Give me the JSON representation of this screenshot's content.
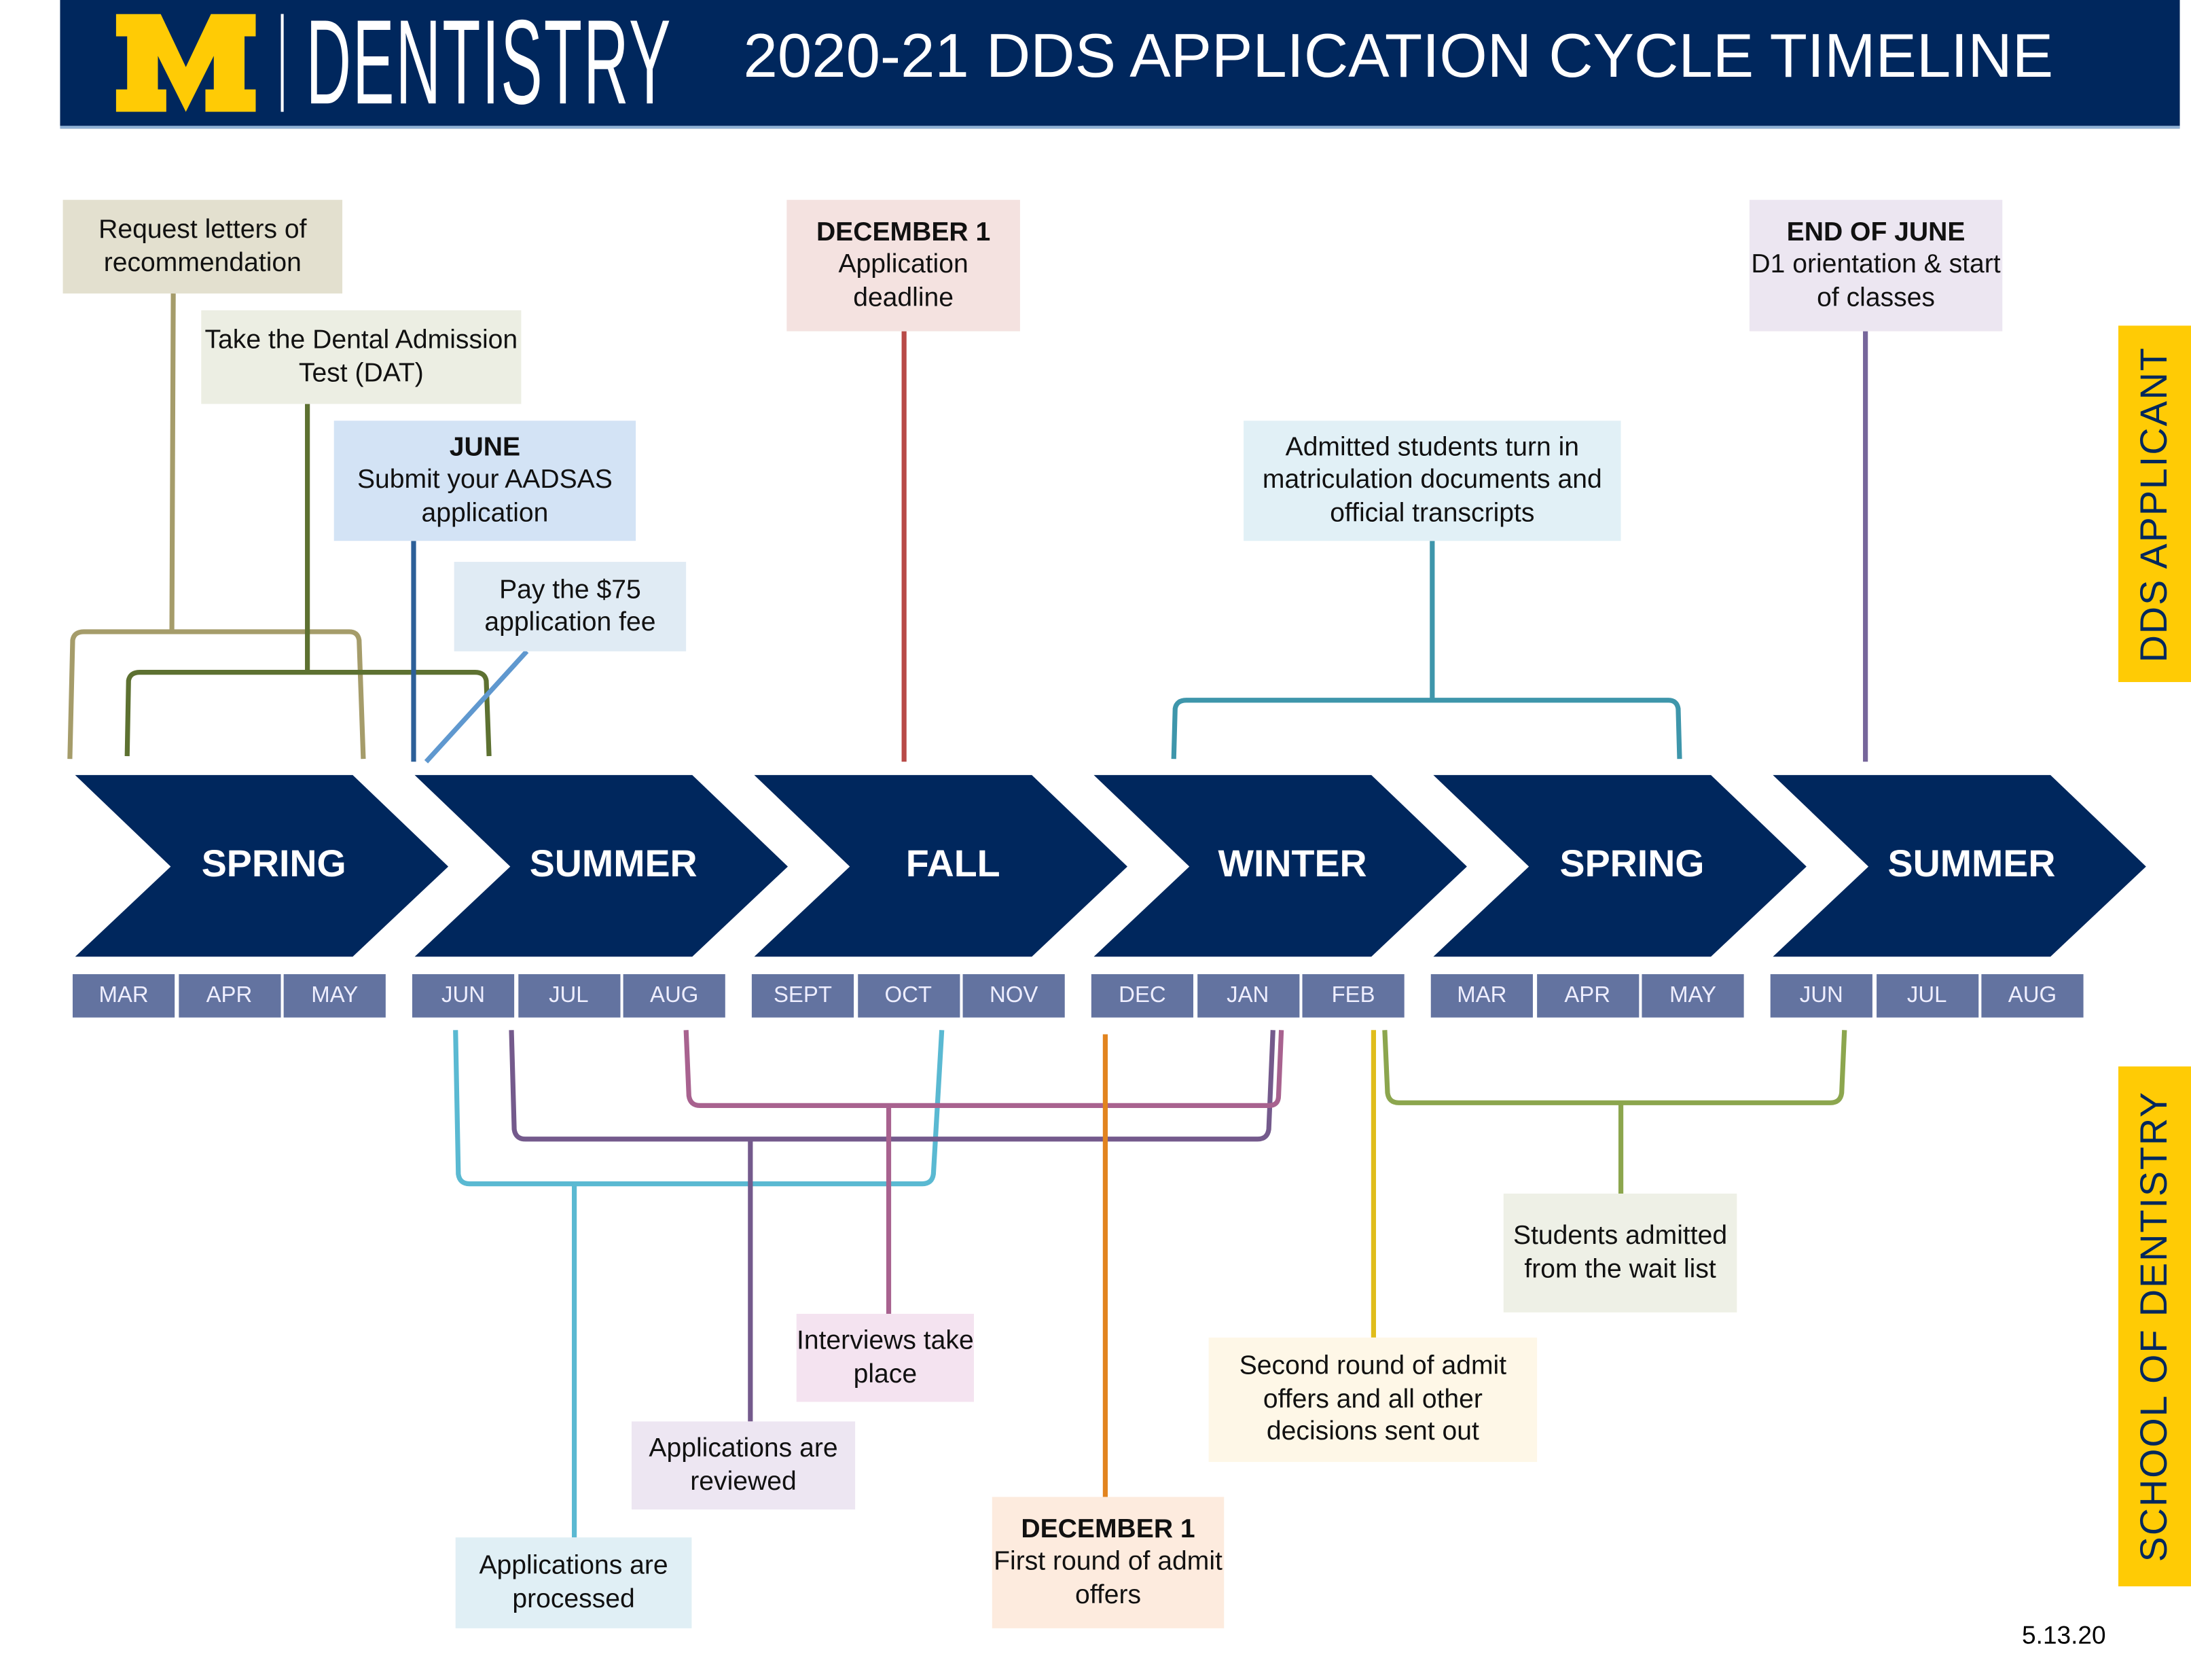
{
  "header": {
    "logo_letter": "M",
    "logo_text": "DENTISTRY",
    "title": "2020-21 DDS APPLICATION CYCLE TIMELINE",
    "colors": {
      "navy": "#00275d",
      "maize": "#ffcb05"
    }
  },
  "side_labels": {
    "top": "DDS APPLICANT",
    "bottom": "SCHOOL OF DENTISTRY"
  },
  "seasons": [
    "SPRING",
    "SUMMER",
    "FALL",
    "WINTER",
    "SPRING",
    "SUMMER"
  ],
  "months": [
    "MAR",
    "APR",
    "MAY",
    "JUN",
    "JUL",
    "AUG",
    "SEPT",
    "OCT",
    "NOV",
    "DEC",
    "JAN",
    "FEB",
    "MAR",
    "APR",
    "MAY",
    "JUN",
    "JUL",
    "AUG"
  ],
  "applicant_events": [
    {
      "heading": "",
      "text": "Request letters of recommendation",
      "color": "#a59c6a",
      "bg": "#e3e0cf"
    },
    {
      "heading": "",
      "text": "Take the Dental Admission Test (DAT)",
      "color": "#5d7131",
      "bg": "#eceee3"
    },
    {
      "heading": "JUNE",
      "text": "Submit your AADSAS application",
      "color": "#2c5f98",
      "bg": "#d3e3f5"
    },
    {
      "heading": "",
      "text": "Pay the $75 application fee",
      "color": "#5f98cf",
      "bg": "#e0ebf4"
    },
    {
      "heading": "DECEMBER 1",
      "text": "Application deadline",
      "color": "#b84a47",
      "bg": "#f4e2e0"
    },
    {
      "heading": "",
      "text": "Admitted students turn in matriculation documents and official transcripts",
      "color": "#3e96ab",
      "bg": "#e1f0f6"
    },
    {
      "heading": "END OF JUNE",
      "text": "D1 orientation & start of classes",
      "color": "#76669b",
      "bg": "#ece6f1"
    }
  ],
  "school_events": [
    {
      "heading": "",
      "text": "Applications are processed",
      "color": "#5ab9d2",
      "bg": "#e0eff5"
    },
    {
      "heading": "",
      "text": "Applications are reviewed",
      "color": "#745a8c",
      "bg": "#ede6f2"
    },
    {
      "heading": "",
      "text": "Interviews take place",
      "color": "#a8628f",
      "bg": "#f4e3f0"
    },
    {
      "heading": "DECEMBER 1",
      "text": "First round of admit offers",
      "color": "#e2841f",
      "bg": "#fdebde"
    },
    {
      "heading": "",
      "text": "Second round of admit offers and all other decisions sent out",
      "color": "#e0bd1b",
      "bg": "#fef7e7"
    },
    {
      "heading": "",
      "text": "Students admitted from the wait list",
      "color": "#8ca64e",
      "bg": "#eef0e6"
    }
  ],
  "footer": {
    "version_date": "5.13.20"
  }
}
